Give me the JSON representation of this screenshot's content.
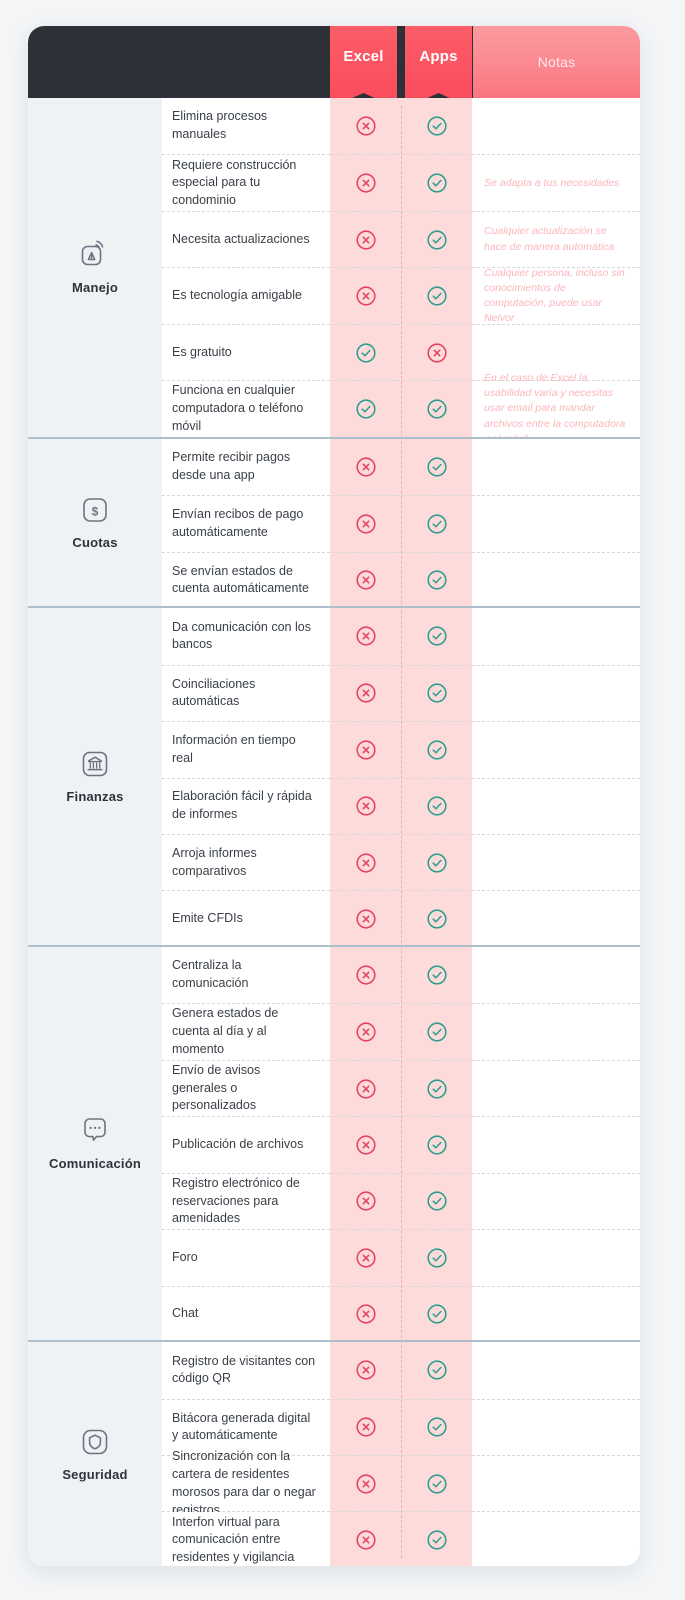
{
  "theme": {
    "page_background": "#f3f5f7",
    "header_dark": "#2d3137",
    "tab_gradient_from": "#fb6069",
    "tab_gradient_to": "#fb4a5c",
    "notas_gradient_from": "#fb9aa0",
    "notas_gradient_to": "#fa757f",
    "pink_band": "#fcdbda",
    "section_label_background": "#eef2f5",
    "section_divider": "#adbecd",
    "check_color": "#2f9e8f",
    "cross_color": "#e8435c",
    "note_text_color": "#fcb6bc"
  },
  "header": {
    "blank_label": "",
    "columns": [
      {
        "id": "excel",
        "label": "Excel",
        "style": "pennant"
      },
      {
        "id": "apps",
        "label": "Apps",
        "style": "pennant"
      },
      {
        "id": "notas",
        "label": "Notas",
        "style": "banner"
      }
    ]
  },
  "sections": [
    {
      "id": "manejo",
      "name": "Manejo",
      "icon": "app-signal-icon",
      "rows": [
        {
          "feature": "Elimina procesos manuales",
          "excel": "cross",
          "apps": "check",
          "note": ""
        },
        {
          "feature": "Requiere construcción especial para tu condominio",
          "excel": "cross",
          "apps": "check",
          "note": "Se adapta a tus necesidades"
        },
        {
          "feature": "Necesita actualizaciones",
          "excel": "cross",
          "apps": "check",
          "note": "Cualquier actualización se hace de manera automática"
        },
        {
          "feature": "Es tecnología amigable",
          "excel": "cross",
          "apps": "check",
          "note": "Cualquier persona, incluso sin conocimientos de computación, puede usar Neivor"
        },
        {
          "feature": "Es gratuito",
          "excel": "check",
          "apps": "cross",
          "note": ""
        },
        {
          "feature": "Funciona en cualquier computadora o teléfono móvil",
          "excel": "check",
          "apps": "check",
          "note": "En el caso de Excel la usabilidad varía y necesitas usar email para mandar archivos entre la computadora y el móvil"
        }
      ]
    },
    {
      "id": "cuotas",
      "name": "Cuotas",
      "icon": "dollar-square-icon",
      "rows": [
        {
          "feature": "Permite recibir pagos desde una app",
          "excel": "cross",
          "apps": "check",
          "note": ""
        },
        {
          "feature": "Envían recibos de pago automáticamente",
          "excel": "cross",
          "apps": "check",
          "note": ""
        },
        {
          "feature": "Se envían estados de cuenta automáticamente",
          "excel": "cross",
          "apps": "check",
          "note": ""
        }
      ]
    },
    {
      "id": "finanzas",
      "name": "Finanzas",
      "icon": "bank-icon",
      "rows": [
        {
          "feature": "Da comunicación con los bancos",
          "excel": "cross",
          "apps": "check",
          "note": ""
        },
        {
          "feature": "Coinciliaciones automáticas",
          "excel": "cross",
          "apps": "check",
          "note": ""
        },
        {
          "feature": "Información en tiempo real",
          "excel": "cross",
          "apps": "check",
          "note": ""
        },
        {
          "feature": "Elaboración fácil y rápida de informes",
          "excel": "cross",
          "apps": "check",
          "note": ""
        },
        {
          "feature": "Arroja informes comparativos",
          "excel": "cross",
          "apps": "check",
          "note": ""
        },
        {
          "feature": "Emite CFDIs",
          "excel": "cross",
          "apps": "check",
          "note": ""
        }
      ]
    },
    {
      "id": "comunicacion",
      "name": "Comunicación",
      "icon": "chat-bubble-icon",
      "rows": [
        {
          "feature": "Centraliza la comunicación",
          "excel": "cross",
          "apps": "check",
          "note": ""
        },
        {
          "feature": "Genera estados de cuenta al día y al momento",
          "excel": "cross",
          "apps": "check",
          "note": ""
        },
        {
          "feature": "Envío de avisos generales o personalizados",
          "excel": "cross",
          "apps": "check",
          "note": ""
        },
        {
          "feature": "Publicación de archivos",
          "excel": "cross",
          "apps": "check",
          "note": ""
        },
        {
          "feature": "Registro electrónico de reservaciones para amenidades",
          "excel": "cross",
          "apps": "check",
          "note": ""
        },
        {
          "feature": "Foro",
          "excel": "cross",
          "apps": "check",
          "note": ""
        },
        {
          "feature": "Chat",
          "excel": "cross",
          "apps": "check",
          "note": ""
        }
      ]
    },
    {
      "id": "seguridad",
      "name": "Seguridad",
      "icon": "shield-square-icon",
      "rows": [
        {
          "feature": "Registro de visitantes con código QR",
          "excel": "cross",
          "apps": "check",
          "note": ""
        },
        {
          "feature": "Bitácora generada digital y automáticamente",
          "excel": "cross",
          "apps": "check",
          "note": ""
        },
        {
          "feature": "Sincronización con la cartera de residentes morosos para dar o negar registros",
          "excel": "cross",
          "apps": "check",
          "note": ""
        },
        {
          "feature": "Interfon virtual para comunicación entre residentes y vigilancia",
          "excel": "cross",
          "apps": "check",
          "note": ""
        }
      ]
    }
  ]
}
